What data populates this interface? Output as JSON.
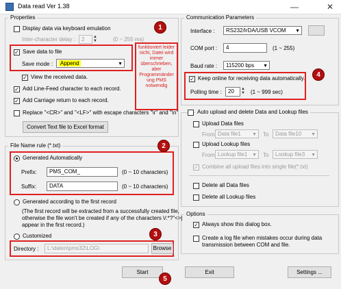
{
  "window": {
    "title": "Data read  Ver 1.38"
  },
  "properties": {
    "group_label": "Properties",
    "keyboard_emulation": "Display data via keyboard emulation",
    "inter_char_label": "Inter-character delay :",
    "inter_char_value": "2",
    "inter_char_range": "(0 ~ 255 ms)",
    "save_to_file": "Save data to file",
    "save_mode_label": "Save mode :",
    "save_mode_value": "Append",
    "view_received": "View the received data.",
    "add_lf": "Add Line-Feed character to each record.",
    "add_cr": "Add Carriage return to each record.",
    "replace_cr_lf": "Replace \"<CR>\" and \"<LF>\" with escape characters \"\\r\" and \"\\n\"",
    "convert_button": "Convert Text file to Excel format",
    "annotation_note": "funktioniert leider nicht, Datei wird immer überschrieben, aber Programmänder ung PMS notwendig"
  },
  "file_name_rule": {
    "group_label": "File Name rule (*.txt)",
    "generated_auto": "Generated Automatically",
    "prefix_label": "Prefix:",
    "prefix_value": "PMS_COM_",
    "prefix_range": "(0 ~ 10 characters)",
    "suffix_label": "Suffix:",
    "suffix_value": "DATA",
    "suffix_range": "(0 ~ 10 characters)",
    "generated_first": "Generated according to the first record",
    "first_desc_1": "(The first record will be extracted from a successfully created file,",
    "first_desc_2": "otherwise the file won't be created if any of the characters \\/:*?\"<>|",
    "first_desc_3": "appear in the first record.)",
    "customized": "Customized",
    "directory_label": "Directory :",
    "directory_value": "L:\\daten\\pms32\\LOG\\",
    "browse_button": "Browse"
  },
  "comm": {
    "group_label": "Communication Parameters",
    "interface_label": "Interface :",
    "interface_value": "RS232/IrDA/USB VCOM",
    "com_port_label": "COM port :",
    "com_port_value": "4",
    "com_port_range": "(1 ~ 255)",
    "baud_label": "Baud rate :",
    "baud_value": "115200 bps",
    "keep_online": "Keep online for receiving data automatically.",
    "polling_label": "Polling time :",
    "polling_value": "20",
    "polling_range": "(1 ~ 999 sec)"
  },
  "auto_upload": {
    "group_label": "Auto upload and delete Data and Lookup files",
    "upload_data": "Upload Data files",
    "from_label": "From",
    "to_label": "To",
    "data_from": "Data file1",
    "data_to": "Data file10",
    "upload_lookup": "Upload Lookup files",
    "lookup_from": "Lookup file1",
    "lookup_to": "Lookup file3",
    "combine": "Combine all upload files into single file(*.txt)",
    "delete_data": "Delete all Data files",
    "delete_lookup": "Delete all Lookup files"
  },
  "options": {
    "group_label": "Options",
    "always_show": "Always show this dialog box.",
    "log_file_1": "Create a log file when mistakes occur during data",
    "log_file_2": "transmission between COM and file."
  },
  "bottom": {
    "start": "Start",
    "exit": "Exit",
    "settings": "Settings ..."
  },
  "badges": {
    "b1": "1",
    "b2": "2",
    "b3": "3",
    "b4": "4",
    "b5": "5"
  },
  "colors": {
    "annotation_red": "#e01f1f",
    "badge_red": "#b40f0f",
    "selected_yellow": "#ffff00"
  }
}
